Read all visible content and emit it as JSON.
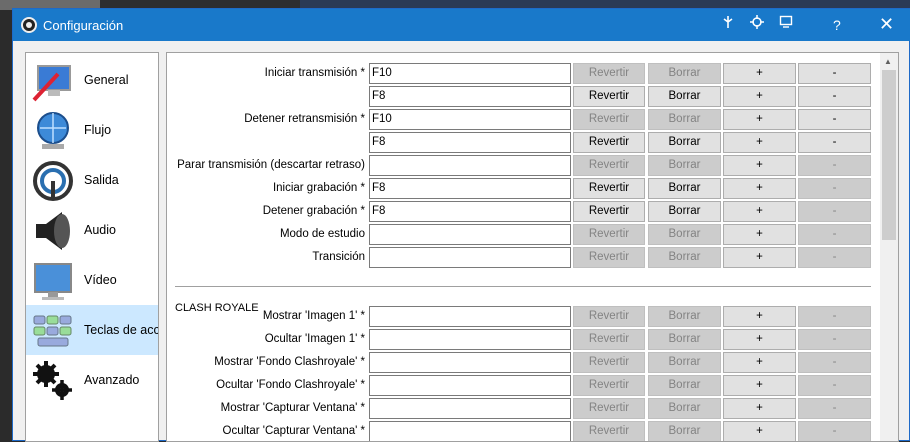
{
  "window": {
    "title": "Configuración",
    "help_label": "?",
    "close_label": "✕"
  },
  "sidebar": {
    "items": [
      {
        "label": "General",
        "icon": "monitor-pen-icon"
      },
      {
        "label": "Flujo",
        "icon": "globe-network-icon"
      },
      {
        "label": "Salida",
        "icon": "broadcast-icon"
      },
      {
        "label": "Audio",
        "icon": "speaker-icon"
      },
      {
        "label": "Vídeo",
        "icon": "display-icon"
      },
      {
        "label": "Teclas de acceso rápido",
        "icon": "keyboard-icon",
        "selected": true
      },
      {
        "label": "Avanzado",
        "icon": "gears-icon"
      }
    ]
  },
  "buttons": {
    "revert": "Revertir",
    "clear": "Borrar",
    "add": "+",
    "remove": "-"
  },
  "hotkeys": [
    {
      "label": "Iniciar transmisión *",
      "value": "F10",
      "revert_enabled": false,
      "remove_enabled": true
    },
    {
      "label": "",
      "value": "F8",
      "revert_enabled": true,
      "remove_enabled": true
    },
    {
      "label": "Detener retransmisión *",
      "value": "F10",
      "revert_enabled": false,
      "remove_enabled": true
    },
    {
      "label": "",
      "value": "F8",
      "revert_enabled": true,
      "remove_enabled": true
    },
    {
      "label": "Parar transmisión (descartar retraso)",
      "value": "",
      "revert_enabled": false,
      "remove_enabled": false
    },
    {
      "label": "Iniciar grabación *",
      "value": "F8",
      "revert_enabled": true,
      "remove_enabled": false
    },
    {
      "label": "Detener grabación *",
      "value": "F8",
      "revert_enabled": true,
      "remove_enabled": false
    },
    {
      "label": "Modo de estudio",
      "value": "",
      "revert_enabled": false,
      "remove_enabled": false
    },
    {
      "label": "Transición",
      "value": "",
      "revert_enabled": false,
      "remove_enabled": false
    }
  ],
  "group": {
    "title": "CLASH ROYALE",
    "rows": [
      {
        "label": "Mostrar 'Imagen 1' *",
        "value": ""
      },
      {
        "label": "Ocultar 'Imagen 1' *",
        "value": ""
      },
      {
        "label": "Mostrar 'Fondo Clashroyale' *",
        "value": ""
      },
      {
        "label": "Ocultar 'Fondo Clashroyale' *",
        "value": ""
      },
      {
        "label": "Mostrar 'Capturar Ventana' *",
        "value": ""
      },
      {
        "label": "Ocultar 'Capturar Ventana' *",
        "value": ""
      }
    ]
  }
}
